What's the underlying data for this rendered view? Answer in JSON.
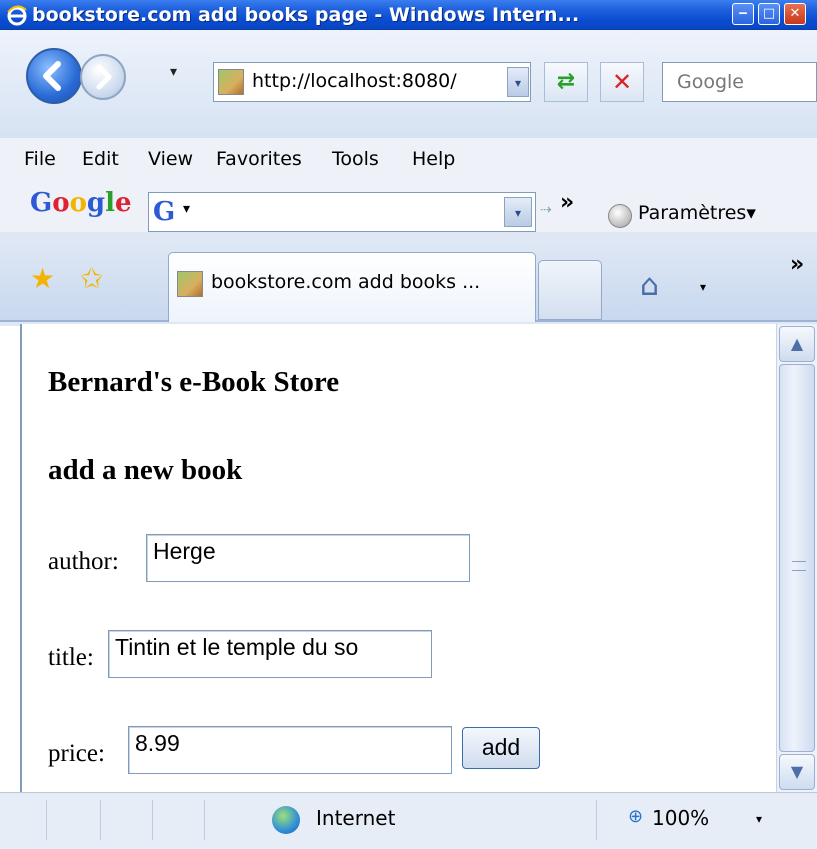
{
  "window": {
    "title": "bookstore.com add books page - Windows Intern...",
    "minimize_glyph": "‒",
    "maximize_glyph": "□",
    "close_glyph": "✕"
  },
  "navbar": {
    "url": "http://localhost:8080/",
    "search_placeholder": "Google",
    "history_glyph": "▾",
    "dropdown_glyph": "▾",
    "refresh_glyph": "⇄",
    "stop_glyph": "✕"
  },
  "menu": {
    "items": [
      "File",
      "Edit",
      "View",
      "Favorites",
      "Tools",
      "Help"
    ]
  },
  "google_toolbar": {
    "logo": "Google",
    "logo_colors": [
      "#2c5ad6",
      "#d23",
      "#f2b400",
      "#2c5ad6",
      "#2aa02a",
      "#d23"
    ],
    "more_glyph": "»",
    "go_glyph": "⇢",
    "settings_label": "Paramètres▾"
  },
  "tabs": {
    "active_label": "bookstore.com add books ...",
    "more_glyph": "»",
    "home_glyph": "⌂",
    "home_dd_glyph": "▾",
    "fav_glyph": "★",
    "add_fav_glyph": "✩"
  },
  "page": {
    "store_title": "Bernard's e-Book Store",
    "section_title": "add a new book",
    "author_label": "author:",
    "author_value": "Herge",
    "title_label": "title:",
    "title_value": "Tintin et le temple du so",
    "price_label": "price:",
    "price_value": "8.99",
    "add_button": "add"
  },
  "scrollbar": {
    "up_glyph": "▲",
    "down_glyph": "▼"
  },
  "status": {
    "zone": "Internet",
    "zoom": "100%",
    "zoom_dd_glyph": "▾",
    "zoom_glyph": "⊕"
  },
  "colors": {
    "titlebar": "#0a4cd0",
    "border": "#7f9db9",
    "chrome_bg": "#dfe7f4"
  }
}
